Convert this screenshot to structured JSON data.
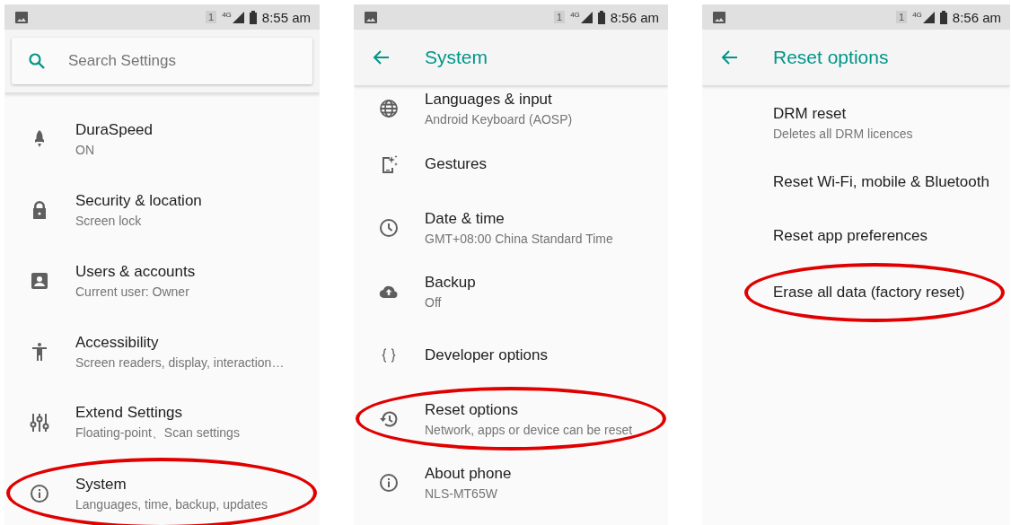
{
  "screens": [
    {
      "status_bar": {
        "sim": "1",
        "network": "4G",
        "time": "8:55 am"
      },
      "kind": "search",
      "search": {
        "placeholder": "Search Settings"
      },
      "items": [
        {
          "title": "DuraSpeed",
          "subtitle": "ON",
          "highlighted": false
        },
        {
          "title": "Security & location",
          "subtitle": "Screen lock",
          "highlighted": false
        },
        {
          "title": "Users & accounts",
          "subtitle": "Current user: Owner",
          "highlighted": false
        },
        {
          "title": "Accessibility",
          "subtitle": "Screen readers, display, interaction…",
          "highlighted": false
        },
        {
          "title": "Extend Settings",
          "subtitle": "Floating-point、Scan settings",
          "highlighted": false
        },
        {
          "title": "System",
          "subtitle": "Languages, time, backup, updates",
          "highlighted": true
        }
      ]
    },
    {
      "status_bar": {
        "sim": "1",
        "network": "4G",
        "time": "8:56 am"
      },
      "kind": "header",
      "header": {
        "title": "System"
      },
      "items": [
        {
          "title": "Languages & input",
          "subtitle": "Android Keyboard (AOSP)",
          "highlighted": false
        },
        {
          "title": "Gestures",
          "highlighted": false
        },
        {
          "title": "Date & time",
          "subtitle": "GMT+08:00 China Standard Time",
          "highlighted": false
        },
        {
          "title": "Backup",
          "subtitle": "Off",
          "highlighted": false
        },
        {
          "title": "Developer options",
          "highlighted": false
        },
        {
          "title": "Reset options",
          "subtitle": "Network, apps or device can be reset",
          "highlighted": true
        },
        {
          "title": "About phone",
          "subtitle": "NLS-MT65W",
          "highlighted": false
        }
      ]
    },
    {
      "status_bar": {
        "sim": "1",
        "network": "4G",
        "time": "8:56 am"
      },
      "kind": "header",
      "header": {
        "title": "Reset options"
      },
      "items": [
        {
          "title": "DRM reset",
          "subtitle": "Deletes all DRM licences",
          "highlighted": false
        },
        {
          "title": "Reset Wi-Fi, mobile & Bluetooth",
          "highlighted": false
        },
        {
          "title": "Reset app preferences",
          "highlighted": false
        },
        {
          "title": "Erase all data (factory reset)",
          "highlighted": true
        }
      ]
    }
  ]
}
